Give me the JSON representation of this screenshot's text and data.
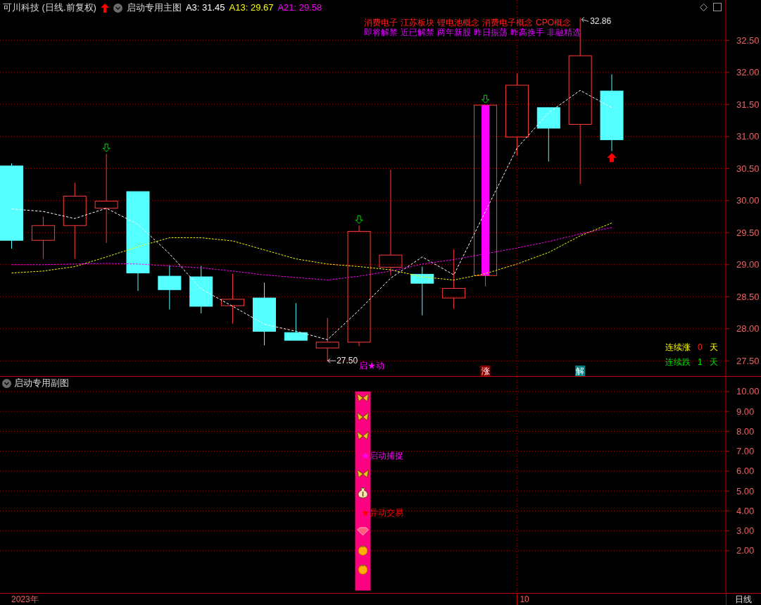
{
  "header": {
    "title": "可川科技 (日线.前复权)",
    "indicator_name": "启动专用主图",
    "indicators": [
      {
        "label": "A3: 31.45",
        "color": "#ffffff"
      },
      {
        "label": "A13: 29.67",
        "color": "#ffff00"
      },
      {
        "label": "A21: 29.58",
        "color": "#ff00ff"
      }
    ]
  },
  "concept_tags": [
    "消费电子",
    "江苏板块",
    "锂电池概念",
    "消费电子概念",
    "CPO概念"
  ],
  "status_tags": [
    "即将解禁",
    "近已解禁",
    "两年新股",
    "昨日振荡",
    "昨高换手",
    "非融精选"
  ],
  "streaks": [
    {
      "kind": "up",
      "label": "连续涨",
      "count": "0",
      "unit": "天"
    },
    {
      "kind": "down",
      "label": "连续跌",
      "count": "1",
      "unit": "天"
    }
  ],
  "main_chart": {
    "chart_data": {
      "type": "line",
      "ylim": [
        27.25,
        33.13
      ],
      "grid": true,
      "categories": [
        null,
        null,
        null,
        null,
        null,
        null,
        null,
        null,
        null,
        null,
        null,
        null,
        null,
        null,
        null,
        null,
        null,
        null,
        null,
        null
      ],
      "yticks": [
        {
          "value": 27.5,
          "label": "27.50"
        },
        {
          "value": 28,
          "label": "28.00"
        },
        {
          "value": 28.5,
          "label": "28.50"
        },
        {
          "value": 29,
          "label": "29.00"
        },
        {
          "value": 29.5,
          "label": "29.50"
        },
        {
          "value": 30,
          "label": "30.00"
        },
        {
          "value": 30.5,
          "label": "30.50"
        },
        {
          "value": 31,
          "label": "31.00"
        },
        {
          "value": 31.5,
          "label": "31.50"
        },
        {
          "value": 32,
          "label": "32.00"
        },
        {
          "value": 32.5,
          "label": "32.50"
        }
      ],
      "series": [
        {
          "color": "#ffffff",
          "line_style": "dashed",
          "values": [
            29.87,
            29.83,
            29.72,
            29.88,
            29.63,
            29.17,
            28.62,
            28.35,
            28.07,
            27.96,
            27.83,
            28.29,
            28.79,
            29.12,
            28.84,
            29.83,
            30.82,
            31.37,
            31.72,
            31.45
          ]
        },
        {
          "color": "#ffff00",
          "line_style": "dashed",
          "values": [
            28.87,
            28.9,
            28.97,
            29.12,
            29.28,
            29.42,
            29.42,
            29.37,
            29.23,
            29.09,
            29.01,
            28.97,
            28.92,
            28.81,
            28.76,
            28.86,
            29.01,
            29.19,
            29.45,
            29.65
          ]
        },
        {
          "color": "#ff00ff",
          "line_style": "dashed",
          "values": [
            29.0,
            29.0,
            29.01,
            29.02,
            29.01,
            28.98,
            28.95,
            28.9,
            28.84,
            28.8,
            28.76,
            28.82,
            28.9,
            29.01,
            29.08,
            29.17,
            29.26,
            29.36,
            29.48,
            29.58
          ]
        }
      ]
    },
    "candles": [
      {
        "highlight": false,
        "down_arrow": false,
        "up_arrow": false,
        "signal_column": false
      },
      {
        "highlight": false,
        "down_arrow": false,
        "up_arrow": false,
        "signal_column": false
      },
      {
        "highlight": false,
        "down_arrow": false,
        "up_arrow": false,
        "signal_column": false
      },
      {
        "highlight": false,
        "down_arrow": true,
        "up_arrow": false,
        "signal_column": false
      },
      {
        "highlight": false,
        "down_arrow": false,
        "up_arrow": false,
        "signal_column": false
      },
      {
        "highlight": false,
        "down_arrow": false,
        "up_arrow": false,
        "signal_column": false
      },
      {
        "highlight": false,
        "down_arrow": false,
        "up_arrow": false,
        "signal_column": false
      },
      {
        "highlight": false,
        "down_arrow": false,
        "up_arrow": false,
        "signal_column": false
      },
      {
        "highlight": false,
        "down_arrow": false,
        "up_arrow": false,
        "signal_column": false
      },
      {
        "highlight": false,
        "down_arrow": false,
        "up_arrow": false,
        "signal_column": false
      },
      {
        "highlight": false,
        "down_arrow": false,
        "up_arrow": false,
        "signal_column": false,
        "low_label": "27.50"
      },
      {
        "highlight": false,
        "down_arrow": true,
        "up_arrow": false,
        "signal_column": true,
        "signal_text": "启★动"
      },
      {
        "highlight": false,
        "down_arrow": false,
        "up_arrow": false,
        "signal_column": false
      },
      {
        "highlight": false,
        "down_arrow": false,
        "up_arrow": false,
        "signal_column": false
      },
      {
        "highlight": false,
        "down_arrow": false,
        "up_arrow": false,
        "signal_column": false
      },
      {
        "highlight": true,
        "down_arrow": true,
        "up_arrow": false,
        "signal_column": false,
        "badge": {
          "kind": "rise",
          "text": "涨"
        }
      },
      {
        "highlight": false,
        "down_arrow": false,
        "up_arrow": false,
        "signal_column": false,
        "month_label": "10"
      },
      {
        "highlight": false,
        "down_arrow": false,
        "up_arrow": false,
        "signal_column": false
      },
      {
        "highlight": false,
        "down_arrow": false,
        "up_arrow": false,
        "signal_column": false,
        "high_label": "32.86",
        "badge": {
          "kind": "unlock",
          "text": "解"
        }
      },
      {
        "highlight": false,
        "down_arrow": false,
        "up_arrow": true,
        "signal_column": false
      }
    ]
  },
  "sub_chart": {
    "title": "启动专用副图",
    "chart_data": {
      "type": "bar",
      "ylim": [
        -0.16,
        10.74
      ],
      "grid": true,
      "categories": [
        null,
        null,
        null,
        null,
        null,
        null,
        null,
        null,
        null,
        null,
        null,
        null,
        null,
        null,
        null,
        null,
        null,
        null,
        null,
        null,
        null,
        null,
        null
      ],
      "series": [
        {
          "color": "#ff0080",
          "values": [
            null,
            null,
            null,
            null,
            null,
            null,
            null,
            null,
            null,
            null,
            null,
            10,
            null,
            null,
            null,
            null,
            null,
            null,
            null,
            null,
            null,
            null,
            null
          ]
        }
      ],
      "yticks": [
        {
          "value": 2,
          "label": "2.00"
        },
        {
          "value": 3,
          "label": "3.00"
        },
        {
          "value": 4,
          "label": "4.00"
        },
        {
          "value": 5,
          "label": "5.00"
        },
        {
          "value": 6,
          "label": "6.00"
        },
        {
          "value": 7,
          "label": "7.00"
        },
        {
          "value": 8,
          "label": "8.00"
        },
        {
          "value": 9,
          "label": "9.00"
        },
        {
          "value": 10,
          "label": "10.00"
        }
      ]
    },
    "signals": [
      {
        "kind": "butterfly"
      },
      {
        "kind": "butterfly"
      },
      {
        "kind": "butterfly"
      },
      {
        "kind": "text",
        "text": "★启动捕捉",
        "color": "#ff00ff"
      },
      {
        "kind": "butterfly"
      },
      {
        "kind": "money-bag"
      },
      {
        "kind": "text",
        "text": "★异动交易",
        "color": "#ff0000"
      },
      {
        "kind": "gem"
      },
      {
        "kind": "fruit"
      },
      {
        "kind": "fruit"
      }
    ]
  },
  "bottom_bar": {
    "year": "2023年",
    "period": "日线"
  }
}
